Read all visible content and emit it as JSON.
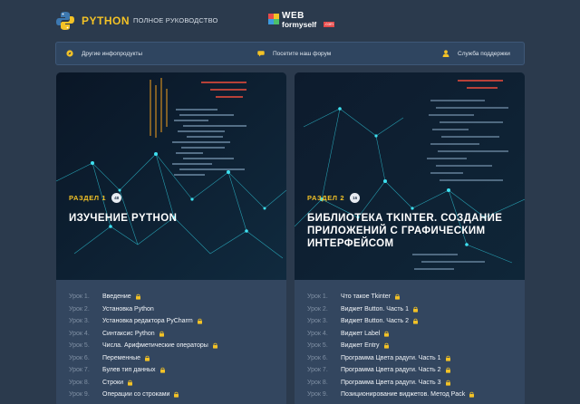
{
  "header": {
    "brand": "PYTHON",
    "tagline": "ПОЛНОЕ РУКОВОДСТВО",
    "partner_top": "WEB",
    "partner_bottom": "formyself",
    "partner_badge": ".com"
  },
  "nav": [
    {
      "label": "Другие инфопродукты",
      "icon": "compass-icon"
    },
    {
      "label": "Посетите наш форум",
      "icon": "chat-icon"
    },
    {
      "label": "Служба поддержки",
      "icon": "user-icon"
    }
  ],
  "colors": {
    "accent": "#f3c226",
    "background": "#2b3a4d",
    "card": "#33465f"
  },
  "sections": [
    {
      "label": "РАЗДЕЛ 1",
      "count": "48",
      "title": "ИЗУЧЕНИЕ PYTHON",
      "lessons": [
        {
          "num": "Урок 1.",
          "title": "Введение"
        },
        {
          "num": "Урок 2.",
          "title": "Установка Python"
        },
        {
          "num": "Урок 3.",
          "title": "Установка редактора PyCharm"
        },
        {
          "num": "Урок 4.",
          "title": "Синтаксис Python"
        },
        {
          "num": "Урок 5.",
          "title": "Числа. Арифметические операторы"
        },
        {
          "num": "Урок 6.",
          "title": "Переменные"
        },
        {
          "num": "Урок 7.",
          "title": "Булев тип данных"
        },
        {
          "num": "Урок 8.",
          "title": "Строки"
        },
        {
          "num": "Урок 9.",
          "title": "Операции со строками"
        }
      ]
    },
    {
      "label": "РАЗДЕЛ 2",
      "count": "16",
      "title": "БИБЛИОТЕКА TKINTER. СОЗДАНИЕ ПРИЛОЖЕНИЙ С ГРАФИЧЕСКИМ ИНТЕРФЕЙСОМ",
      "lessons": [
        {
          "num": "Урок 1.",
          "title": "Что такое Tkinter"
        },
        {
          "num": "Урок 2.",
          "title": "Виджет Button. Часть 1"
        },
        {
          "num": "Урок 3.",
          "title": "Виджет Button. Часть 2"
        },
        {
          "num": "Урок 4.",
          "title": "Виджет Label"
        },
        {
          "num": "Урок 5.",
          "title": "Виджет Entry"
        },
        {
          "num": "Урок 6.",
          "title": "Программа Цвета радуги. Часть 1"
        },
        {
          "num": "Урок 7.",
          "title": "Программа Цвета радуги. Часть 2"
        },
        {
          "num": "Урок 8.",
          "title": "Программа Цвета радуги. Часть 3"
        },
        {
          "num": "Урок 9.",
          "title": "Позиционирование виджетов. Метод Pack"
        }
      ]
    }
  ]
}
